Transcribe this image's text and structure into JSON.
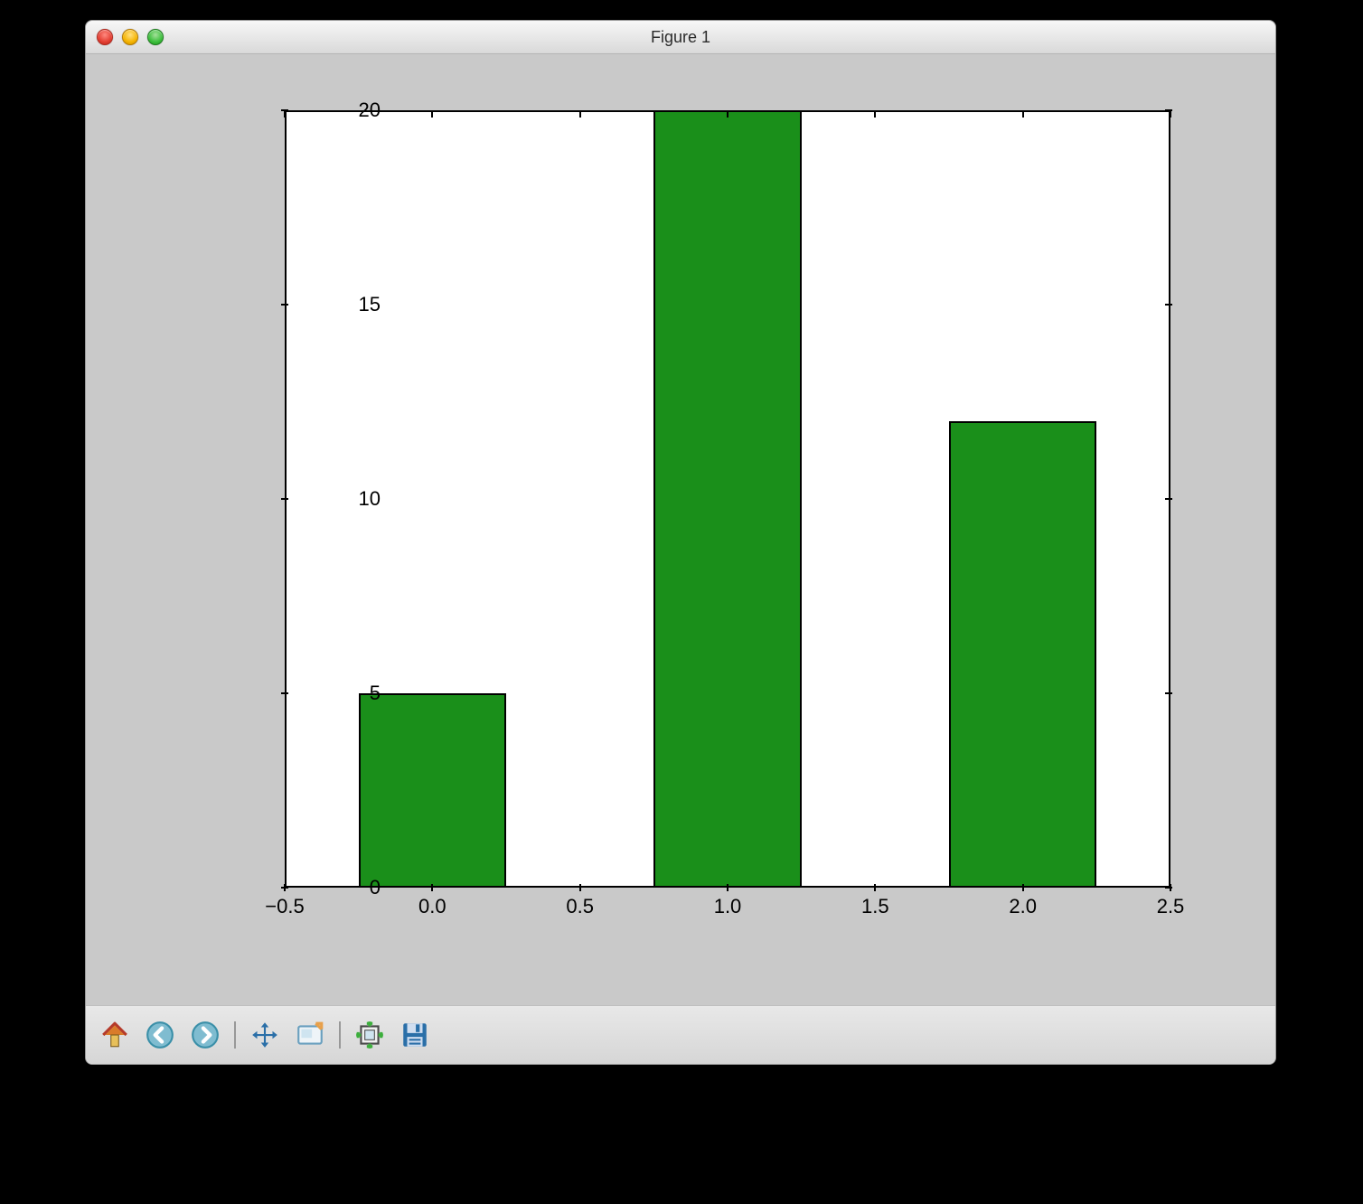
{
  "window": {
    "title": "Figure 1"
  },
  "chart_data": {
    "type": "bar",
    "x": [
      0.0,
      1.0,
      2.0
    ],
    "values": [
      5,
      20,
      12
    ],
    "bar_width": 0.5,
    "xlim": [
      -0.5,
      2.5
    ],
    "ylim": [
      0,
      20
    ],
    "xticks": [
      "-0.5",
      "0.0",
      "0.5",
      "1.0",
      "1.5",
      "2.0",
      "2.5"
    ],
    "yticks": [
      "0",
      "5",
      "10",
      "15",
      "20"
    ],
    "bar_color": "#1a8f1a",
    "title": "",
    "xlabel": "",
    "ylabel": ""
  },
  "toolbar": {
    "home": "Home",
    "back": "Back",
    "forward": "Forward",
    "pan": "Pan",
    "zoom": "Zoom",
    "subplots": "Configure subplots",
    "save": "Save"
  }
}
